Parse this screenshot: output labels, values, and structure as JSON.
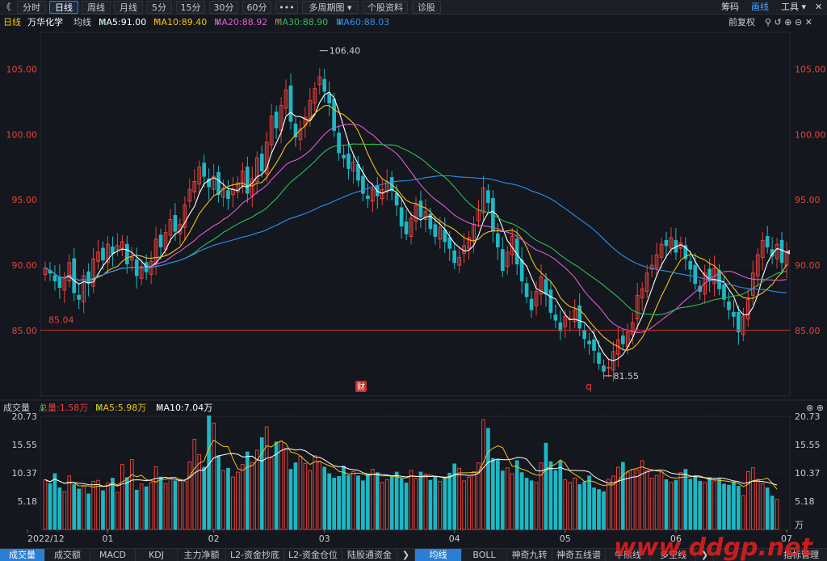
{
  "toolbar": {
    "left_arrow": "《",
    "periods": [
      "分时",
      "日线",
      "周线",
      "月线",
      "5分",
      "15分",
      "30分",
      "60分",
      "•••",
      "多周期图",
      "个股资料",
      "诊股"
    ],
    "active": "日线",
    "right": [
      "筹码",
      "画线",
      "工具"
    ]
  },
  "info": {
    "period": "日线",
    "name": "万华化学",
    "line_label": "均线",
    "ma5": "MA5:91.00",
    "ma10": "MA10:89.40",
    "ma20": "MA20:88.92",
    "ma30": "MA30:88.90",
    "ma60": "MA60:88.03",
    "fq": "前复权"
  },
  "volume_panel": {
    "title": "成交量",
    "total": "总量:1.58万",
    "ma5": "MA5:5.98万",
    "ma10": "MA10:7.04万"
  },
  "bottom_tabs": [
    "成交量",
    "成交额",
    "MACD",
    "KDJ",
    "主力净额",
    "L2-资金抄底",
    "L2-资金仓位",
    "陆股通资金",
    "均线",
    "BOLL",
    "神奇九转",
    "神奇五线谱",
    "牛熊线",
    "多空线",
    "指标管理"
  ],
  "bottom_active": [
    "成交量",
    "均线"
  ],
  "watermark": "www.ddgp.net",
  "colors": {
    "up": "#e8413d",
    "down": "#1cb8c4",
    "ma5": "#ffffff",
    "ma10": "#f0c419",
    "ma20": "#e25ad6",
    "ma30": "#2bbd5b",
    "ma60": "#2f8ff0",
    "axis_text": "#e8413d"
  },
  "chart_data": {
    "type": "candlestick",
    "price_axis": {
      "ticks": [
        "105.00",
        "100.00",
        "95.00",
        "90.00",
        "85.00"
      ],
      "range": [
        80.0,
        107.8
      ]
    },
    "volume_axis": {
      "ticks": [
        "20.73",
        "15.55",
        "10.37",
        "5.18"
      ],
      "unit": "万",
      "range": [
        0,
        20.73
      ]
    },
    "x_labels": [
      "2022/12",
      "01",
      "02",
      "03",
      "04",
      "05",
      "06",
      "07"
    ],
    "markers": {
      "high": "106.40",
      "low": "81.55",
      "line": "85.04",
      "event1": "财",
      "event2": "q"
    },
    "closes": [
      89.8,
      89.4,
      88.8,
      88.3,
      89.0,
      90.2,
      87.9,
      87.4,
      89.2,
      88.6,
      90.5,
      91.0,
      90.4,
      91.6,
      90.9,
      91.5,
      91.8,
      90.1,
      90.6,
      89.2,
      89.9,
      89.5,
      90.3,
      92.0,
      91.4,
      92.5,
      93.5,
      92.6,
      93.1,
      94.6,
      95.8,
      96.4,
      97.5,
      96.8,
      96.0,
      96.8,
      95.4,
      95.9,
      95.1,
      95.8,
      96.3,
      97.2,
      95.5,
      96.6,
      98.2,
      97.2,
      99.4,
      101.4,
      100.5,
      102.2,
      103.4,
      101.0,
      99.8,
      100.4,
      101.3,
      102.6,
      103.5,
      104.4,
      103.3,
      102.4,
      100.3,
      98.6,
      98.2,
      97.4,
      97.9,
      96.5,
      95.5,
      95.1,
      95.8,
      95.3,
      95.8,
      96.4,
      95.7,
      94.6,
      93.0,
      92.4,
      93.6,
      94.6,
      93.7,
      94.1,
      92.8,
      92.2,
      92.9,
      91.8,
      91.3,
      90.2,
      90.6,
      91.5,
      92.1,
      93.1,
      94.2,
      95.9,
      94.8,
      92.6,
      91.4,
      89.6,
      91.0,
      92.2,
      90.1,
      88.8,
      87.6,
      86.6,
      88.0,
      89.1,
      87.8,
      86.4,
      85.8,
      85.0,
      86.1,
      85.9,
      86.6,
      85.2,
      84.4,
      84.0,
      83.5,
      82.5,
      81.9,
      82.2,
      83.4,
      84.3,
      84.0,
      84.9,
      85.6,
      87.7,
      88.2,
      89.4,
      90.0,
      90.8,
      91.6,
      91.5,
      92.1,
      91.0,
      91.7,
      90.5,
      89.7,
      88.6,
      88.0,
      89.4,
      88.8,
      89.8,
      88.2,
      87.4,
      86.6,
      86.1,
      84.9,
      86.1,
      87.4,
      89.4,
      90.8,
      91.9,
      91.4,
      90.7,
      91.6,
      90.2,
      91.0
    ],
    "volumes": [
      9.1,
      8.4,
      10.2,
      7.6,
      6.9,
      9.8,
      8.2,
      7.4,
      7.9,
      6.5,
      8.8,
      9.0,
      7.1,
      8.5,
      9.4,
      6.8,
      11.9,
      9.5,
      12.8,
      7.2,
      8.3,
      7.8,
      8.6,
      11.5,
      9.6,
      8.4,
      9.5,
      8.9,
      9.2,
      8.8,
      12.4,
      16.5,
      13.7,
      11.4,
      20.8,
      19.5,
      13.5,
      10.8,
      11.2,
      9.6,
      10.5,
      11.9,
      14.2,
      12.3,
      14.5,
      16.8,
      18.8,
      13.1,
      16.0,
      16.2,
      14.6,
      11.0,
      12.2,
      13.4,
      12.1,
      10.8,
      13.5,
      12.5,
      11.4,
      10.2,
      9.4,
      9.7,
      11.6,
      9.9,
      10.6,
      9.8,
      8.9,
      10.1,
      11.0,
      10.4,
      8.6,
      9.1,
      9.8,
      10.5,
      9.3,
      8.5,
      10.8,
      9.4,
      10.5,
      10.1,
      9.0,
      9.7,
      8.8,
      9.5,
      10.3,
      12.0,
      11.2,
      8.9,
      9.6,
      10.6,
      12.2,
      20.1,
      18.5,
      13.0,
      12.8,
      10.7,
      11.3,
      10.2,
      12.6,
      10.4,
      9.4,
      8.9,
      8.6,
      12.2,
      15.8,
      12.4,
      10.8,
      12.5,
      9.1,
      8.6,
      9.4,
      8.2,
      8.7,
      9.8,
      7.6,
      7.3,
      6.9,
      9.2,
      9.8,
      11.4,
      12.3,
      10.5,
      11.0,
      10.9,
      12.6,
      10.8,
      9.4,
      9.9,
      10.5,
      9.1,
      8.6,
      9.0,
      10.4,
      11.0,
      9.2,
      9.7,
      8.8,
      8.6,
      9.5,
      8.9,
      9.2,
      8.3,
      8.1,
      8.7,
      7.9,
      6.2,
      10.6,
      11.3,
      9.2,
      8.4,
      7.6,
      6.1,
      5.5
    ]
  }
}
